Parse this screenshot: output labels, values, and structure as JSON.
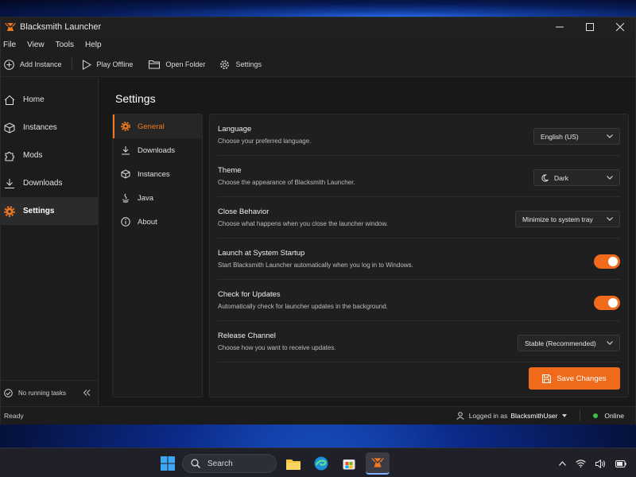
{
  "app": {
    "title": "Blacksmith Launcher",
    "accent_color": "#f07a22"
  },
  "window_controls": {
    "minimize": "—",
    "maximize": "☐",
    "close": "✕"
  },
  "menu": [
    "File",
    "View",
    "Tools",
    "Help"
  ],
  "toolbar": {
    "add_instance": "Add Instance",
    "play_offline": "Play Offline",
    "open_folder": "Open Folder",
    "settings": "Settings"
  },
  "sidebar": {
    "items": [
      {
        "label": "Home",
        "icon": "home-icon"
      },
      {
        "label": "Instances",
        "icon": "cube-icon"
      },
      {
        "label": "Mods",
        "icon": "puzzle-icon"
      },
      {
        "label": "Downloads",
        "icon": "download-icon"
      },
      {
        "label": "Settings",
        "icon": "gear-icon",
        "active": true
      }
    ],
    "footer": "No running tasks"
  },
  "page": {
    "title": "Settings"
  },
  "subnav": {
    "items": [
      {
        "label": "General",
        "icon": "gear-icon",
        "active": true
      },
      {
        "label": "Downloads",
        "icon": "download-icon"
      },
      {
        "label": "Instances",
        "icon": "cube-icon"
      },
      {
        "label": "Java",
        "icon": "java-icon"
      },
      {
        "label": "About",
        "icon": "info-icon"
      }
    ]
  },
  "settings": {
    "language": {
      "title": "Language",
      "desc": "Choose your preferred language.",
      "value": "English (US)"
    },
    "theme": {
      "title": "Theme",
      "desc": "Choose the appearance of Blacksmith Launcher.",
      "value": "Dark"
    },
    "close_behavior": {
      "title": "Close Behavior",
      "desc": "Choose what happens when you close the launcher window.",
      "value": "Minimize to system tray"
    },
    "startup": {
      "title": "Launch at System Startup",
      "desc": "Start Blacksmith Launcher automatically when you log in to Windows.",
      "enabled": true
    },
    "updates": {
      "title": "Check for Updates",
      "desc": "Automatically check for launcher updates in the background.",
      "enabled": true
    },
    "channel": {
      "title": "Release Channel",
      "desc": "Choose how you want to receive updates.",
      "value": "Stable (Recommended)"
    },
    "save_label": "Save Changes"
  },
  "status": {
    "ready": "Ready",
    "logged_in_as": "Logged in as",
    "username": "BlacksmithUser",
    "online": "Online"
  },
  "taskbar": {
    "search_placeholder": "Search"
  }
}
